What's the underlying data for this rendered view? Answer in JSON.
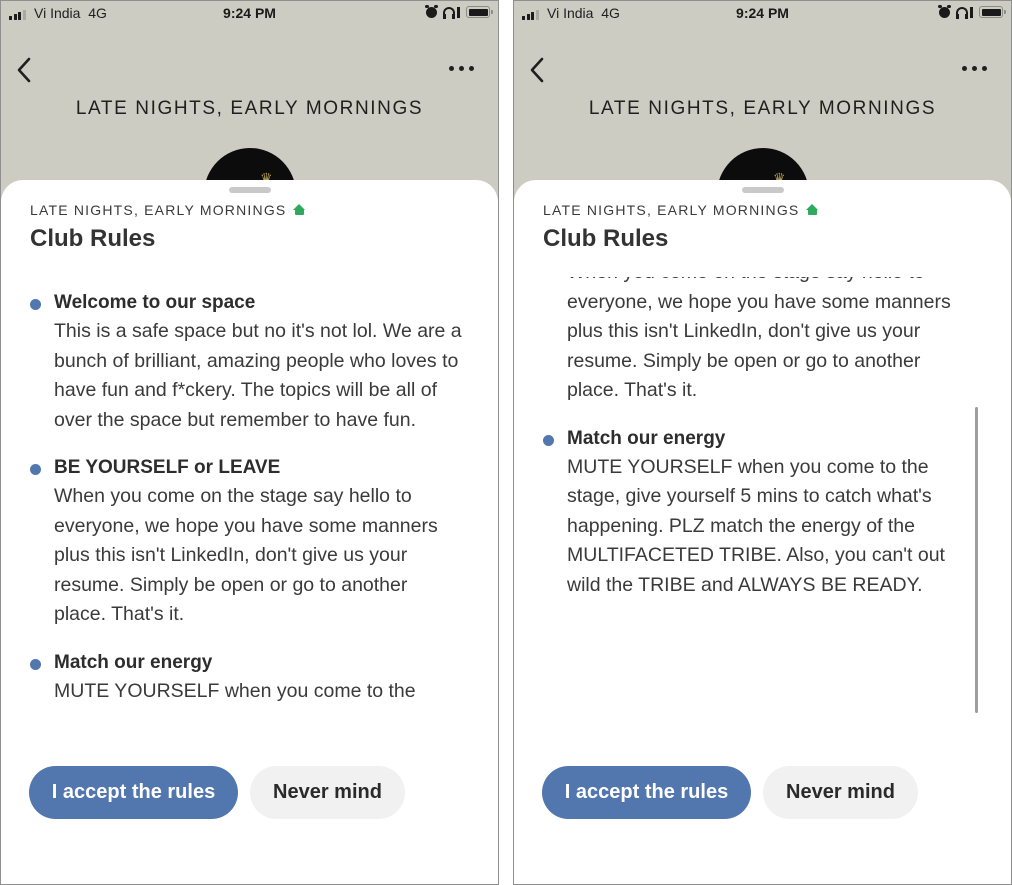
{
  "status_bar": {
    "carrier": "Vi India",
    "network": "4G",
    "time": "9:24 PM",
    "icons": [
      "signal-icon",
      "alarm-icon",
      "headphones-icon",
      "battery-icon"
    ]
  },
  "nav": {
    "back_icon": "chevron-left-icon",
    "more_icon": "ellipsis-icon",
    "club_name": "LATE NIGHTS, EARLY MORNINGS"
  },
  "sheet": {
    "kicker": "LATE NIGHTS, EARLY MORNINGS",
    "kicker_icon": "home-icon",
    "title": "Club Rules",
    "rules": [
      {
        "title": "Welcome to our space",
        "body": "This is a safe space but no it's not lol. We are a bunch of brilliant, amazing people who loves to have fun and f*ckery. The topics will be all of over the space but remember to have fun."
      },
      {
        "title": "BE YOURSELF or LEAVE",
        "body": "When you come on the stage say hello to everyone, we hope you have some manners plus this isn't LinkedIn, don't give us your resume. Simply be open or go to another place. That's it."
      },
      {
        "title": "Match our energy",
        "body": "MUTE YOURSELF when you come to the stage, give yourself 5 mins to catch what's happening. PLZ match the energy of the MULTIFACETED TRIBE. Also, you can't out wild the TRIBE and ALWAYS BE READY."
      }
    ],
    "accept_label": "I accept the rules",
    "cancel_label": "Never mind",
    "accent_color": "#5276ae",
    "home_icon_color": "#2eaa5c"
  },
  "panels": [
    {
      "name": "before-scroll"
    },
    {
      "name": "after-scroll"
    }
  ]
}
